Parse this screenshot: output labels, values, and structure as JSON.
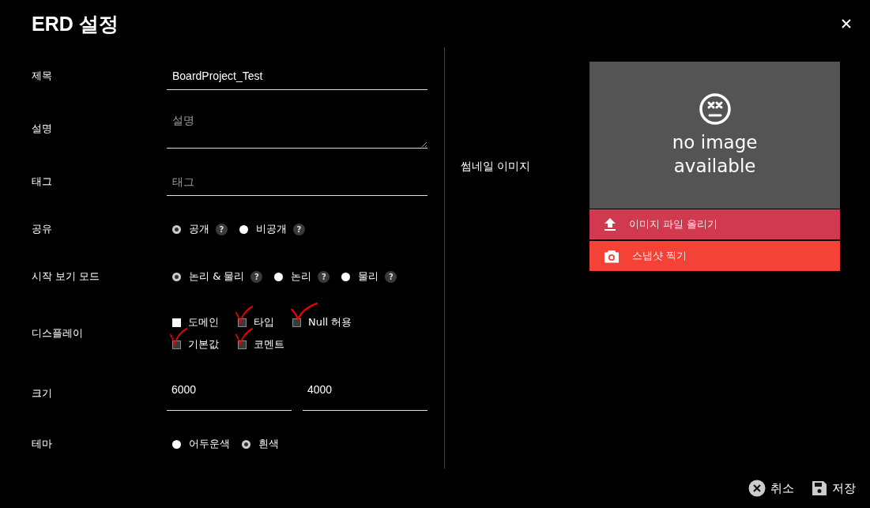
{
  "dialog": {
    "title": "ERD 설정"
  },
  "fields": [
    {
      "kind": "text",
      "label": "제목",
      "value": "BoardProject_Test"
    },
    {
      "kind": "textarea",
      "label": "설명",
      "placeholder": "설명"
    },
    {
      "kind": "text",
      "label": "태그",
      "placeholder": "태그"
    },
    {
      "kind": "radio",
      "label": "공유",
      "options": [
        {
          "label": "공개",
          "selected": true,
          "help": "?"
        },
        {
          "label": "비공개",
          "selected": false,
          "help": "?"
        }
      ]
    },
    {
      "kind": "radio",
      "label": "시작 보기 모드",
      "options": [
        {
          "label": "논리 & 물리",
          "selected": true,
          "help": "?"
        },
        {
          "label": "논리",
          "selected": false,
          "help": "?"
        },
        {
          "label": "물리",
          "selected": false,
          "help": "?"
        }
      ]
    },
    {
      "kind": "checks",
      "label": "디스플레이",
      "options": [
        {
          "label": "도메인",
          "checked": false,
          "annotated": false
        },
        {
          "label": "타입",
          "checked": true,
          "annotated": true
        },
        {
          "label": "Null 허용",
          "checked": true,
          "annotated": true
        },
        {
          "label": "기본값",
          "checked": true,
          "annotated": true
        },
        {
          "label": "코멘트",
          "checked": true,
          "annotated": true
        }
      ]
    },
    {
      "kind": "pair",
      "label": "크기",
      "values": [
        "6000",
        "4000"
      ]
    },
    {
      "kind": "radio",
      "label": "테마",
      "options": [
        {
          "label": "어두운색",
          "selected": false
        },
        {
          "label": "흰색",
          "selected": true
        }
      ]
    }
  ],
  "thumbnail": {
    "label": "썸네일 이미지",
    "placeholder": "no image available",
    "upload": "이미지 파일 올리기",
    "snapshot": "스냅샷 찍기"
  },
  "footer": {
    "cancel": "취소",
    "save": "저장"
  }
}
